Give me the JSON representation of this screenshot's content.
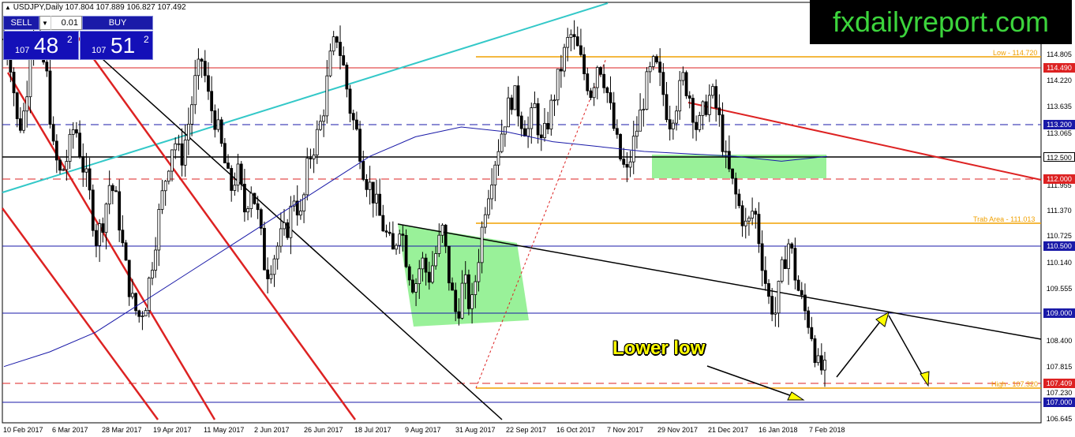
{
  "symbol_header": "USDJPY,Daily  107.804 107.889 106.827 107.492",
  "trade_panel": {
    "sell_label": "SELL",
    "buy_label": "BUY",
    "quantity": "0.01",
    "bid": {
      "small": "107",
      "big": "48",
      "sup": "2"
    },
    "ask": {
      "small": "107",
      "big": "51",
      "sup": "2"
    }
  },
  "brand": "fxdailyreport.com",
  "price_ticks": [
    "114.805",
    "114.220",
    "113.635",
    "113.065",
    "111.955",
    "111.370",
    "110.725",
    "110.140",
    "109.555",
    "108.400",
    "107.815",
    "107.230",
    "106.645"
  ],
  "price_boxes": [
    {
      "label": "114.490",
      "price": 114.49,
      "bg": "#dd2222",
      "fg": "#ffffff"
    },
    {
      "label": "113.200",
      "price": 113.2,
      "bg": "#1a1aa8",
      "fg": "#ffffff"
    },
    {
      "label": "112.500",
      "price": 112.5,
      "bg": "#ffffff",
      "fg": "#000000"
    },
    {
      "label": "112.000",
      "price": 112.0,
      "bg": "#dd2222",
      "fg": "#ffffff"
    },
    {
      "label": "110.500",
      "price": 110.5,
      "bg": "#1a1aa8",
      "fg": "#ffffff"
    },
    {
      "label": "109.000",
      "price": 109.0,
      "bg": "#1a1aa8",
      "fg": "#ffffff"
    },
    {
      "label": "107.409",
      "price": 107.409,
      "bg": "#dd2222",
      "fg": "#ffffff"
    },
    {
      "label": "107.000",
      "price": 107.0,
      "bg": "#1a1aa8",
      "fg": "#ffffff"
    }
  ],
  "date_labels": [
    "10 Feb 2017",
    "6 Mar 2017",
    "28 Mar 2017",
    "19 Apr 2017",
    "11 May 2017",
    "2 Jun 2017",
    "26 Jun 2017",
    "18 Jul 2017",
    "9 Aug 2017",
    "31 Aug 2017",
    "22 Sep 2017",
    "16 Oct 2017",
    "7 Nov 2017",
    "29 Nov 2017",
    "21 Dec 2017",
    "16 Jan 2018",
    "7 Feb 2018"
  ],
  "level_labels": {
    "low": "Low - 114.720",
    "trap": "Trab Area - 111.013",
    "high": "High - 107.320"
  },
  "annotation": "Lower low",
  "colors": {
    "blue_line": "#1a1aa8",
    "red_line": "#dd2222",
    "orange_line": "#f0a000",
    "cyan_line": "#33c8c8",
    "green_zone": "#8ef08e",
    "ma_line": "#1a1aa8",
    "arrow_fill": "#ffff00"
  },
  "chart_data": {
    "type": "candlestick",
    "ohlc_path": [
      114.3,
      113.8,
      112.4,
      112.9,
      114.6,
      114.1,
      113.6,
      112.0,
      111.5,
      111.9,
      112.6,
      111.8,
      111.2,
      110.2,
      110.6,
      111.4,
      110.9,
      109.8,
      109.0,
      108.6,
      108.9,
      109.8,
      110.8,
      111.6,
      112.3,
      111.8,
      112.5,
      113.4,
      113.9,
      113.0,
      112.6,
      111.9,
      111.2,
      111.6,
      110.8,
      111.3,
      110.6,
      109.5,
      109.8,
      110.2,
      110.4,
      111.1,
      110.6,
      111.8,
      112.2,
      112.7,
      113.8,
      114.4,
      113.7,
      112.8,
      112.3,
      111.5,
      111.2,
      110.7,
      110.3,
      109.9,
      110.6,
      109.7,
      109.2,
      109.8,
      109.4,
      109.9,
      110.4,
      109.3,
      108.6,
      109.4,
      108.7,
      109.8,
      110.9,
      111.6,
      112.2,
      112.8,
      113.2,
      112.7,
      112.4,
      112.9,
      112.1,
      112.7,
      113.3,
      113.9,
      114.4,
      114.1,
      113.6,
      113.2,
      113.9,
      113.4,
      112.6,
      111.9,
      111.5,
      112.2,
      112.8,
      113.5,
      113.8,
      113.3,
      112.6,
      113.0,
      113.5,
      113.1,
      112.4,
      112.9,
      113.2,
      112.7,
      111.8,
      111.3,
      110.8,
      110.4,
      110.9,
      109.9,
      109.0,
      108.7,
      109.6,
      110.2,
      109.3,
      108.8,
      108.4,
      107.6,
      107.49
    ],
    "moving_average_path": [
      107.6,
      107.9,
      108.3,
      108.9,
      109.5,
      110.1,
      110.7,
      111.3,
      111.9,
      112.3,
      112.5,
      112.4,
      112.2,
      112.1,
      112.0,
      111.95,
      111.9,
      111.8,
      111.9
    ]
  }
}
